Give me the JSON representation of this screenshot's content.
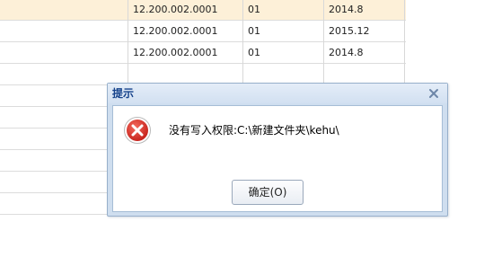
{
  "table": {
    "rows": [
      {
        "code": "12.200.002.0001",
        "type": "01",
        "date": "2014.8",
        "selected": true
      },
      {
        "code": "12.200.002.0001",
        "type": "01",
        "date": "2015.12",
        "selected": false
      },
      {
        "code": "12.200.002.0001",
        "type": "01",
        "date": "2014.8",
        "selected": false
      },
      {
        "code": "",
        "type": "",
        "date": "",
        "selected": false
      },
      {
        "code": "",
        "type": "",
        "date": "",
        "selected": false
      },
      {
        "code": "",
        "type": "",
        "date": "",
        "selected": false
      },
      {
        "code": "",
        "type": "",
        "date": "",
        "selected": false
      },
      {
        "code": "",
        "type": "",
        "date": "",
        "selected": false
      },
      {
        "code": "",
        "type": "",
        "date": "",
        "selected": false
      },
      {
        "code": "",
        "type": "",
        "date": "",
        "selected": false
      }
    ]
  },
  "dialog": {
    "title": "提示",
    "message": "没有写入权限:C:\\新建文件夹\\kehu\\",
    "ok_label": "确定(O)",
    "icon": "error-icon",
    "close_icon": "close-icon"
  },
  "colors": {
    "selected_row": "#fdf0d8",
    "title_text": "#15428b",
    "dialog_frame": "#cfdeef",
    "error_red": "#d9302a"
  }
}
